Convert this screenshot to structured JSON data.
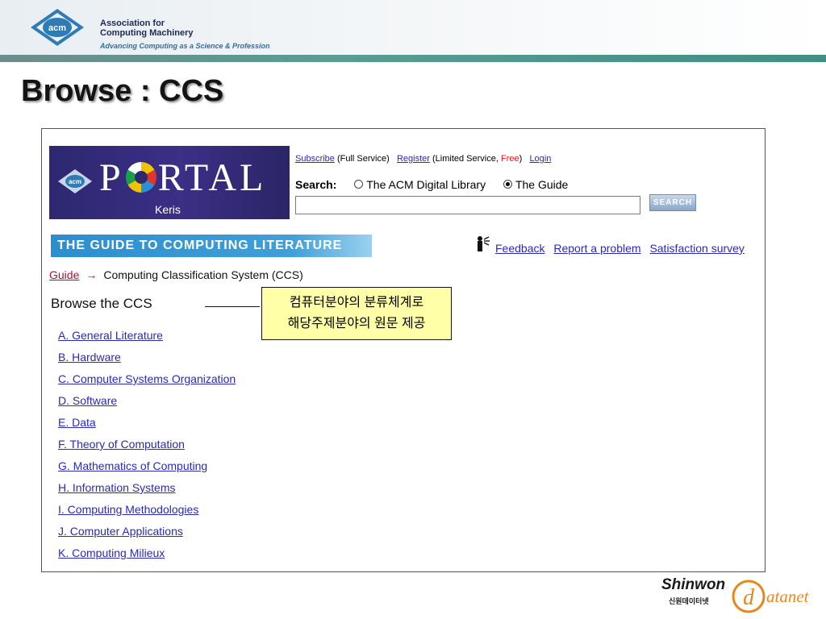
{
  "header": {
    "org_line1": "Association for",
    "org_line2": "Computing Machinery",
    "tagline": "Advancing Computing as a Science & Profession",
    "acm_logo": "acm"
  },
  "slide": {
    "title": "Browse : CCS"
  },
  "portal": {
    "logo_acm": "acm",
    "logo_p": "P",
    "logo_rtal": "RTAL",
    "logo_sub": "Keris",
    "subscribe": "Subscribe",
    "subscribe_note": "(Full Service)",
    "register": "Register",
    "register_note_a": "(Limited Service, ",
    "register_free": "Free",
    "register_note_b": ")",
    "login": "Login",
    "search_label": "Search:",
    "radio_dl": "The ACM Digital Library",
    "radio_guide": "The Guide",
    "search_value": "",
    "search_button": "SEARCH"
  },
  "guide_banner": "THE GUIDE TO COMPUTING LITERATURE",
  "feedback": {
    "icon": "feedback-icon",
    "feedback": "Feedback",
    "report": "Report a problem",
    "survey": "Satisfaction survey"
  },
  "breadcrumb": {
    "guide": "Guide",
    "arrow": "→",
    "current": "Computing Classification System (CCS)"
  },
  "browse_heading": "Browse the CCS",
  "callout": {
    "line1": "컴퓨터분야의 분류체계로",
    "line2": "해당주제분야의 원문 제공"
  },
  "ccs_categories": [
    "A. General Literature",
    "B. Hardware",
    "C. Computer Systems Organization",
    "D. Software",
    "E. Data",
    "F. Theory of Computation",
    "G. Mathematics of Computing",
    "H. Information Systems",
    "I. Computing Methodologies",
    "J. Computer Applications",
    "K. Computing Milieux"
  ],
  "footer_logo": {
    "shinwon": "Shinwon",
    "shinwon_kr": "신원데이터넷",
    "d": "d",
    "atanet": "atanet"
  },
  "colors": {
    "title_text": "#141414",
    "link": "#2a2ab6",
    "guide_banner": "#2c8ecf",
    "callout_bg": "#ffffa8",
    "portal_bg": "#2d2870"
  }
}
